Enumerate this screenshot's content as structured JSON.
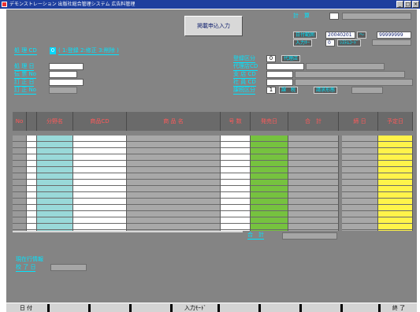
{
  "window": {
    "title": "デモンストレーション 出版社総合管理システム 広告料管理",
    "controls": [
      "_",
      "□",
      "×"
    ]
  },
  "header": {
    "calc_label": "計　算",
    "entry_button": "掲載申込入力"
  },
  "date_range": {
    "label": "日付範囲",
    "from": "20040201",
    "sep": "～",
    "to": "99999999"
  },
  "input_key": {
    "label": "入力ｷｰ",
    "value": "0",
    "name": "ｼｽﾃﾑｺｰﾄﾞ"
  },
  "mode": {
    "label": "処 理 CD",
    "value": "0",
    "hint": "( 1:登録 2:修正 3:削除 )"
  },
  "left_fields": [
    {
      "label": "処 理 日"
    },
    {
      "label": "伝 票 No"
    },
    {
      "label": "訂 正 日"
    },
    {
      "label": "訂 正 No"
    }
  ],
  "right_fields": {
    "register_type": {
      "label": "登録区分",
      "value": "0",
      "extra": "代理店"
    },
    "agent_cd": {
      "label": "代理店CD"
    },
    "branch_cd": {
      "label": "支 店 CD"
    },
    "staff_cd": {
      "label": "社 員 CD"
    },
    "tax_type": {
      "label": "課税区分",
      "value": "1",
      "tax": "課　税",
      "billing": "請求形態"
    }
  },
  "table": {
    "columns": [
      "No",
      "分野名",
      "商品CD",
      "商 品 名",
      "号 数",
      "発売日",
      "合　計",
      "締 日",
      "予定日"
    ],
    "row_count": 15,
    "total_label": "合　計"
  },
  "colors": {
    "bg_gray": "#848484",
    "cyan_col": "#99d9d9",
    "green_col": "#76c23f",
    "yellow_col": "#fff34a",
    "label_cyan": "#00e5ff",
    "header_red": "#ff5a5a"
  },
  "status": {
    "title": "現在行情報",
    "end_date_label": "校 了 日"
  },
  "function_keys": [
    "日 付",
    "",
    "",
    "",
    "入力ﾓｰﾄﾞ",
    "",
    "",
    "",
    "終 了"
  ]
}
